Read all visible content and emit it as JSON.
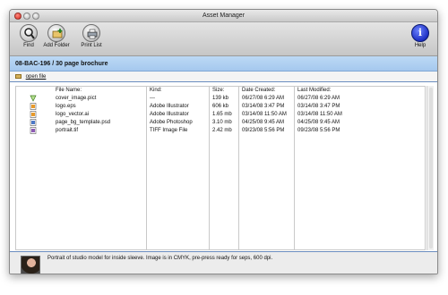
{
  "window": {
    "title": "Asset Manager"
  },
  "toolbar": {
    "find_label": "Find",
    "add_folder_label": "Add Folder",
    "print_list_label": "Print List",
    "help_label": "Help",
    "help_glyph": "i"
  },
  "project": {
    "title": "08-BAC-196 / 30 page brochure"
  },
  "open": {
    "label": "open file"
  },
  "table": {
    "headers": {
      "name": "File Name:",
      "kind": "Kind:",
      "size": "Size:",
      "created": "Date Created:",
      "modified": "Last Modified:"
    },
    "rows": [
      {
        "icon": "cover-image-icon",
        "name": "cover_image.pict",
        "kind": "---",
        "size": "139 kb",
        "created": "06/27/08 6:29 AM",
        "modified": "06/27/08 6:29 AM"
      },
      {
        "icon": "illustrator-file-icon",
        "name": "logo.eps",
        "kind": "Adobe Illustrator",
        "size": "606 kb",
        "created": "03/14/08 3:47 PM",
        "modified": "03/14/08 3:47 PM"
      },
      {
        "icon": "illustrator-file-icon",
        "name": "logo_vector.ai",
        "kind": "Adobe Illustrator",
        "size": "1.65 mb",
        "created": "03/14/08 11:50 AM",
        "modified": "03/14/08 11:50 AM"
      },
      {
        "icon": "photoshop-file-icon",
        "name": "page_bg_template.psd",
        "kind": "Adobe Photoshop",
        "size": "3.10 mb",
        "created": "04/25/08 9:45 AM",
        "modified": "04/25/08 9:45 AM"
      },
      {
        "icon": "tiff-file-icon",
        "name": "portrait.tif",
        "kind": "TIFF Image File",
        "size": "2.42 mb",
        "created": "09/23/08 5:56 PM",
        "modified": "09/23/08 5:56 PM"
      }
    ]
  },
  "preview": {
    "description": "Portrait of studio model for inside sleeve. Image is in CMYK, pre-press ready for seps, 600 dpi."
  },
  "colors": {
    "project_bar": "#a9cbef",
    "divider": "#6b8dbf"
  }
}
